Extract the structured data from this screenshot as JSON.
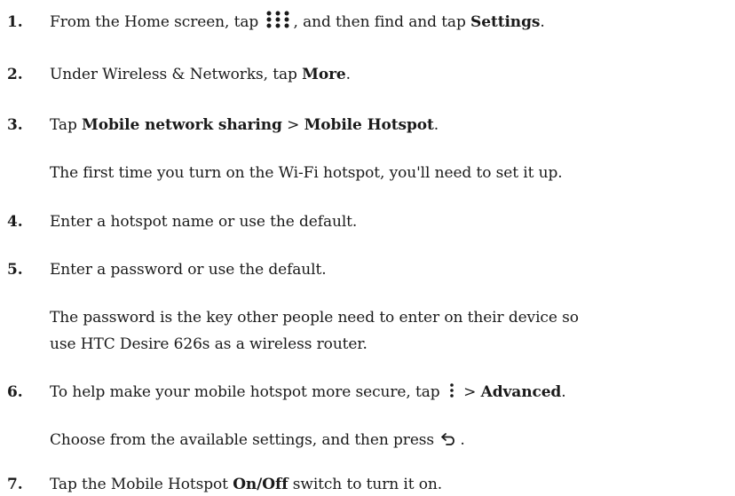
{
  "steps": [
    {
      "number": "1.",
      "pre": "From the Home screen, tap ",
      "icon": "apps-grid-icon",
      "mid": ", and then find and tap ",
      "bold": "Settings",
      "post": "."
    },
    {
      "number": "2.",
      "pre": "Under Wireless & Networks, tap ",
      "bold": "More",
      "post": "."
    },
    {
      "number": "3.",
      "pre": "Tap ",
      "bold1": "Mobile network sharing",
      "mid": " > ",
      "bold2": "Mobile Hotspot",
      "post": "."
    },
    {
      "note": "The first time you turn on the Wi-Fi hotspot, you'll need to set it up."
    },
    {
      "number": "4.",
      "text": "Enter a hotspot name or use the default."
    },
    {
      "number": "5.",
      "text": "Enter a password or use the default."
    },
    {
      "note_line1": "The password is the key other people need to enter on their device so",
      "note_line2": "use HTC Desire 626s as a wireless router."
    },
    {
      "number": "6.",
      "pre": "To help make your mobile hotspot more secure, tap ",
      "icon": "more-options-icon",
      "mid": " > ",
      "bold": "Advanced",
      "post": "."
    },
    {
      "note_pre": "Choose from the available settings, and then press ",
      "icon": "back-icon",
      "note_post": "."
    },
    {
      "number": "7.",
      "pre": "Tap the Mobile Hotspot ",
      "bold": "On/Off",
      "post": " switch to turn it on."
    }
  ]
}
